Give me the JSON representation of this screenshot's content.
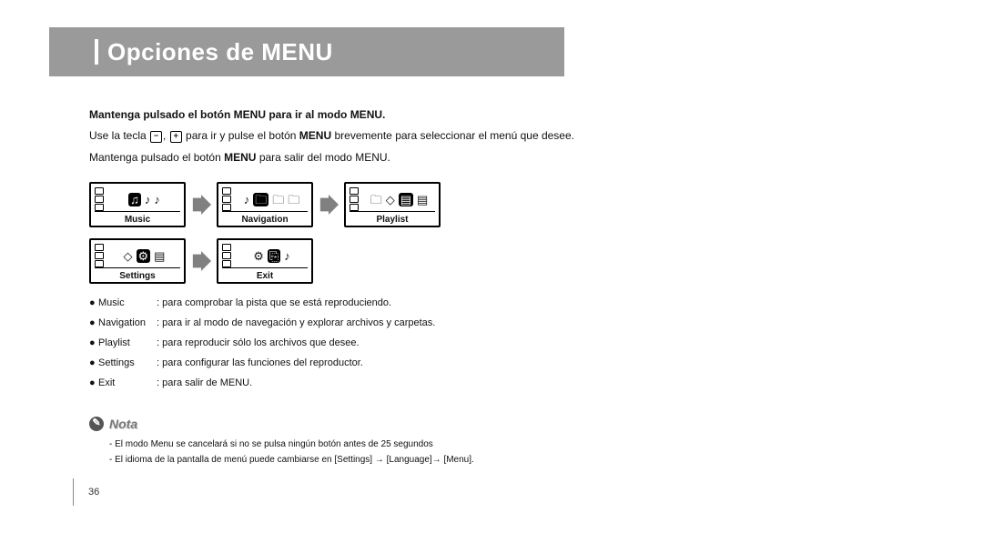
{
  "title": "Opciones de MENU",
  "intro": {
    "lead": "Mantenga pulsado el botón  MENU  para ir al modo MENU.",
    "line2_a": "Use la tecla ",
    "line2_b": " para ir y pulse el botón ",
    "line2_menu": "MENU",
    "line2_c": "  brevemente para seleccionar el menú que desee.",
    "line3_a": "Mantenga pulsado el botón ",
    "line3_menu": "MENU",
    "line3_b": " para salir del modo MENU."
  },
  "tiles": {
    "music": "Music",
    "navigation": "Navigation",
    "playlist": "Playlist",
    "settings": "Settings",
    "exit": "Exit"
  },
  "bullets": [
    {
      "key": "Music",
      "val": ": para comprobar la pista que se está reproduciendo."
    },
    {
      "key": "Navigation",
      "val": ": para ir al modo de navegación y explorar archivos y carpetas."
    },
    {
      "key": "Playlist",
      "val": ": para reproducir sólo los archivos que desee."
    },
    {
      "key": "Settings",
      "val": ": para configurar las funciones del reproductor."
    },
    {
      "key": "Exit",
      "val": ": para salir de MENU."
    }
  ],
  "nota": {
    "title": "Nota",
    "items": [
      "- El modo Menu se cancelará si no se pulsa ningún botón antes de 25 segundos",
      "- El idioma de la pantalla de menú puede cambiarse en [Settings] → [Language]→ [Menu]."
    ]
  },
  "page_number": "36",
  "glyph": {
    "minus": "−",
    "plus": "+",
    "comma": ", "
  }
}
